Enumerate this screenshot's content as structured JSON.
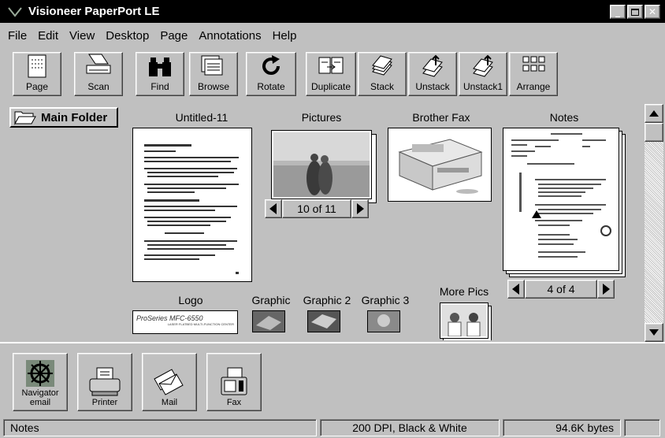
{
  "window": {
    "title": "Visioneer PaperPort LE"
  },
  "menu": [
    "File",
    "Edit",
    "View",
    "Desktop",
    "Page",
    "Annotations",
    "Help"
  ],
  "toolbar": {
    "page": "Page",
    "scan": "Scan",
    "find": "Find",
    "browse": "Browse",
    "rotate": "Rotate",
    "duplicate": "Duplicate",
    "stack": "Stack",
    "unstack": "Unstack",
    "unstack1": "Unstack1",
    "arrange": "Arrange"
  },
  "folders": {
    "main": "Main Folder"
  },
  "desktop": {
    "untitled": "Untitled-11",
    "pictures": "Pictures",
    "pictures_pager": "10 of 11",
    "brother_fax": "Brother Fax",
    "notes": "Notes",
    "notes_pager": "4 of 4",
    "logo": "Logo",
    "logo_text": "ProSeries MFC-6550",
    "logo_sub": "LASER FLATBED MULTI-FUNCTION CENTER",
    "graphic": "Graphic",
    "graphic2": "Graphic 2",
    "graphic3": "Graphic 3",
    "more_pics": "More Pics"
  },
  "links": {
    "navigator": "Navigator email",
    "printer": "Printer",
    "mail": "Mail",
    "fax": "Fax"
  },
  "status": {
    "item": "Notes",
    "dpi": "200 DPI, Black & White",
    "size": "94.6K bytes"
  }
}
